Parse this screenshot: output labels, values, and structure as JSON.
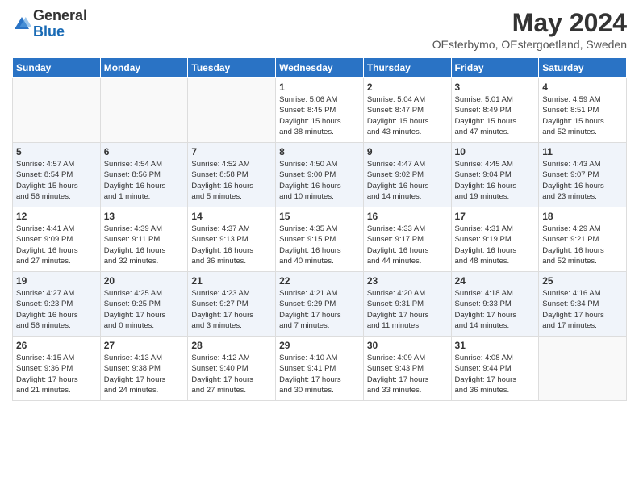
{
  "logo": {
    "general": "General",
    "blue": "Blue"
  },
  "title": "May 2024",
  "subtitle": "OEsterbymo, OEstergoetland, Sweden",
  "days_of_week": [
    "Sunday",
    "Monday",
    "Tuesday",
    "Wednesday",
    "Thursday",
    "Friday",
    "Saturday"
  ],
  "weeks": [
    [
      {
        "day": "",
        "info": ""
      },
      {
        "day": "",
        "info": ""
      },
      {
        "day": "",
        "info": ""
      },
      {
        "day": "1",
        "info": "Sunrise: 5:06 AM\nSunset: 8:45 PM\nDaylight: 15 hours\nand 38 minutes."
      },
      {
        "day": "2",
        "info": "Sunrise: 5:04 AM\nSunset: 8:47 PM\nDaylight: 15 hours\nand 43 minutes."
      },
      {
        "day": "3",
        "info": "Sunrise: 5:01 AM\nSunset: 8:49 PM\nDaylight: 15 hours\nand 47 minutes."
      },
      {
        "day": "4",
        "info": "Sunrise: 4:59 AM\nSunset: 8:51 PM\nDaylight: 15 hours\nand 52 minutes."
      }
    ],
    [
      {
        "day": "5",
        "info": "Sunrise: 4:57 AM\nSunset: 8:54 PM\nDaylight: 15 hours\nand 56 minutes."
      },
      {
        "day": "6",
        "info": "Sunrise: 4:54 AM\nSunset: 8:56 PM\nDaylight: 16 hours\nand 1 minute."
      },
      {
        "day": "7",
        "info": "Sunrise: 4:52 AM\nSunset: 8:58 PM\nDaylight: 16 hours\nand 5 minutes."
      },
      {
        "day": "8",
        "info": "Sunrise: 4:50 AM\nSunset: 9:00 PM\nDaylight: 16 hours\nand 10 minutes."
      },
      {
        "day": "9",
        "info": "Sunrise: 4:47 AM\nSunset: 9:02 PM\nDaylight: 16 hours\nand 14 minutes."
      },
      {
        "day": "10",
        "info": "Sunrise: 4:45 AM\nSunset: 9:04 PM\nDaylight: 16 hours\nand 19 minutes."
      },
      {
        "day": "11",
        "info": "Sunrise: 4:43 AM\nSunset: 9:07 PM\nDaylight: 16 hours\nand 23 minutes."
      }
    ],
    [
      {
        "day": "12",
        "info": "Sunrise: 4:41 AM\nSunset: 9:09 PM\nDaylight: 16 hours\nand 27 minutes."
      },
      {
        "day": "13",
        "info": "Sunrise: 4:39 AM\nSunset: 9:11 PM\nDaylight: 16 hours\nand 32 minutes."
      },
      {
        "day": "14",
        "info": "Sunrise: 4:37 AM\nSunset: 9:13 PM\nDaylight: 16 hours\nand 36 minutes."
      },
      {
        "day": "15",
        "info": "Sunrise: 4:35 AM\nSunset: 9:15 PM\nDaylight: 16 hours\nand 40 minutes."
      },
      {
        "day": "16",
        "info": "Sunrise: 4:33 AM\nSunset: 9:17 PM\nDaylight: 16 hours\nand 44 minutes."
      },
      {
        "day": "17",
        "info": "Sunrise: 4:31 AM\nSunset: 9:19 PM\nDaylight: 16 hours\nand 48 minutes."
      },
      {
        "day": "18",
        "info": "Sunrise: 4:29 AM\nSunset: 9:21 PM\nDaylight: 16 hours\nand 52 minutes."
      }
    ],
    [
      {
        "day": "19",
        "info": "Sunrise: 4:27 AM\nSunset: 9:23 PM\nDaylight: 16 hours\nand 56 minutes."
      },
      {
        "day": "20",
        "info": "Sunrise: 4:25 AM\nSunset: 9:25 PM\nDaylight: 17 hours\nand 0 minutes."
      },
      {
        "day": "21",
        "info": "Sunrise: 4:23 AM\nSunset: 9:27 PM\nDaylight: 17 hours\nand 3 minutes."
      },
      {
        "day": "22",
        "info": "Sunrise: 4:21 AM\nSunset: 9:29 PM\nDaylight: 17 hours\nand 7 minutes."
      },
      {
        "day": "23",
        "info": "Sunrise: 4:20 AM\nSunset: 9:31 PM\nDaylight: 17 hours\nand 11 minutes."
      },
      {
        "day": "24",
        "info": "Sunrise: 4:18 AM\nSunset: 9:33 PM\nDaylight: 17 hours\nand 14 minutes."
      },
      {
        "day": "25",
        "info": "Sunrise: 4:16 AM\nSunset: 9:34 PM\nDaylight: 17 hours\nand 17 minutes."
      }
    ],
    [
      {
        "day": "26",
        "info": "Sunrise: 4:15 AM\nSunset: 9:36 PM\nDaylight: 17 hours\nand 21 minutes."
      },
      {
        "day": "27",
        "info": "Sunrise: 4:13 AM\nSunset: 9:38 PM\nDaylight: 17 hours\nand 24 minutes."
      },
      {
        "day": "28",
        "info": "Sunrise: 4:12 AM\nSunset: 9:40 PM\nDaylight: 17 hours\nand 27 minutes."
      },
      {
        "day": "29",
        "info": "Sunrise: 4:10 AM\nSunset: 9:41 PM\nDaylight: 17 hours\nand 30 minutes."
      },
      {
        "day": "30",
        "info": "Sunrise: 4:09 AM\nSunset: 9:43 PM\nDaylight: 17 hours\nand 33 minutes."
      },
      {
        "day": "31",
        "info": "Sunrise: 4:08 AM\nSunset: 9:44 PM\nDaylight: 17 hours\nand 36 minutes."
      },
      {
        "day": "",
        "info": ""
      }
    ]
  ]
}
